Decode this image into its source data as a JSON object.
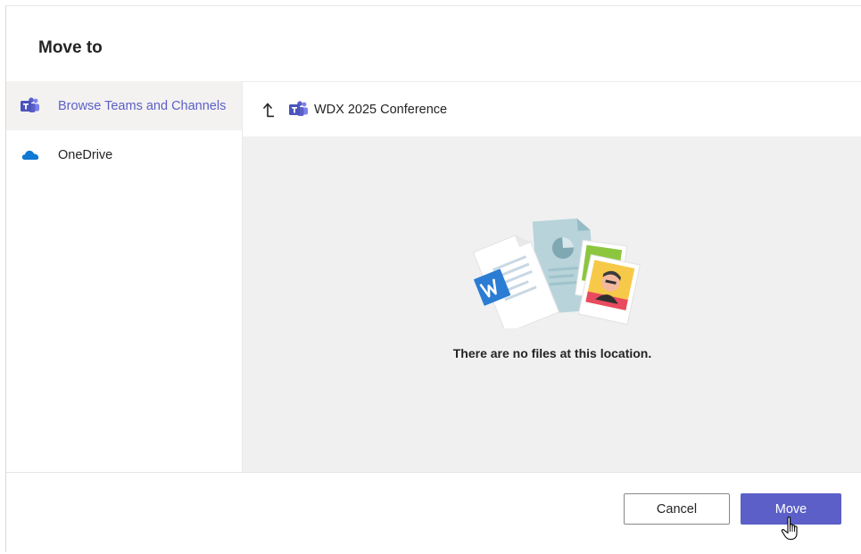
{
  "dialog": {
    "title": "Move to"
  },
  "sidebar": {
    "items": [
      {
        "label": "Browse Teams and Channels",
        "icon": "teams-icon",
        "active": true
      },
      {
        "label": "OneDrive",
        "icon": "onedrive-icon",
        "active": false
      }
    ]
  },
  "location": {
    "up_icon": "up-arrow-icon",
    "icon": "teams-icon",
    "label": "WDX 2025 Conference"
  },
  "empty_state": {
    "message": "There are no files at this location.",
    "illustration": "empty-files-illustration"
  },
  "footer": {
    "cancel_label": "Cancel",
    "move_label": "Move"
  },
  "colors": {
    "accent": "#5b5fc7",
    "onedrive": "#0f78d4",
    "main_bg": "#f0f0f1",
    "active_bg": "#f3f2f1"
  }
}
